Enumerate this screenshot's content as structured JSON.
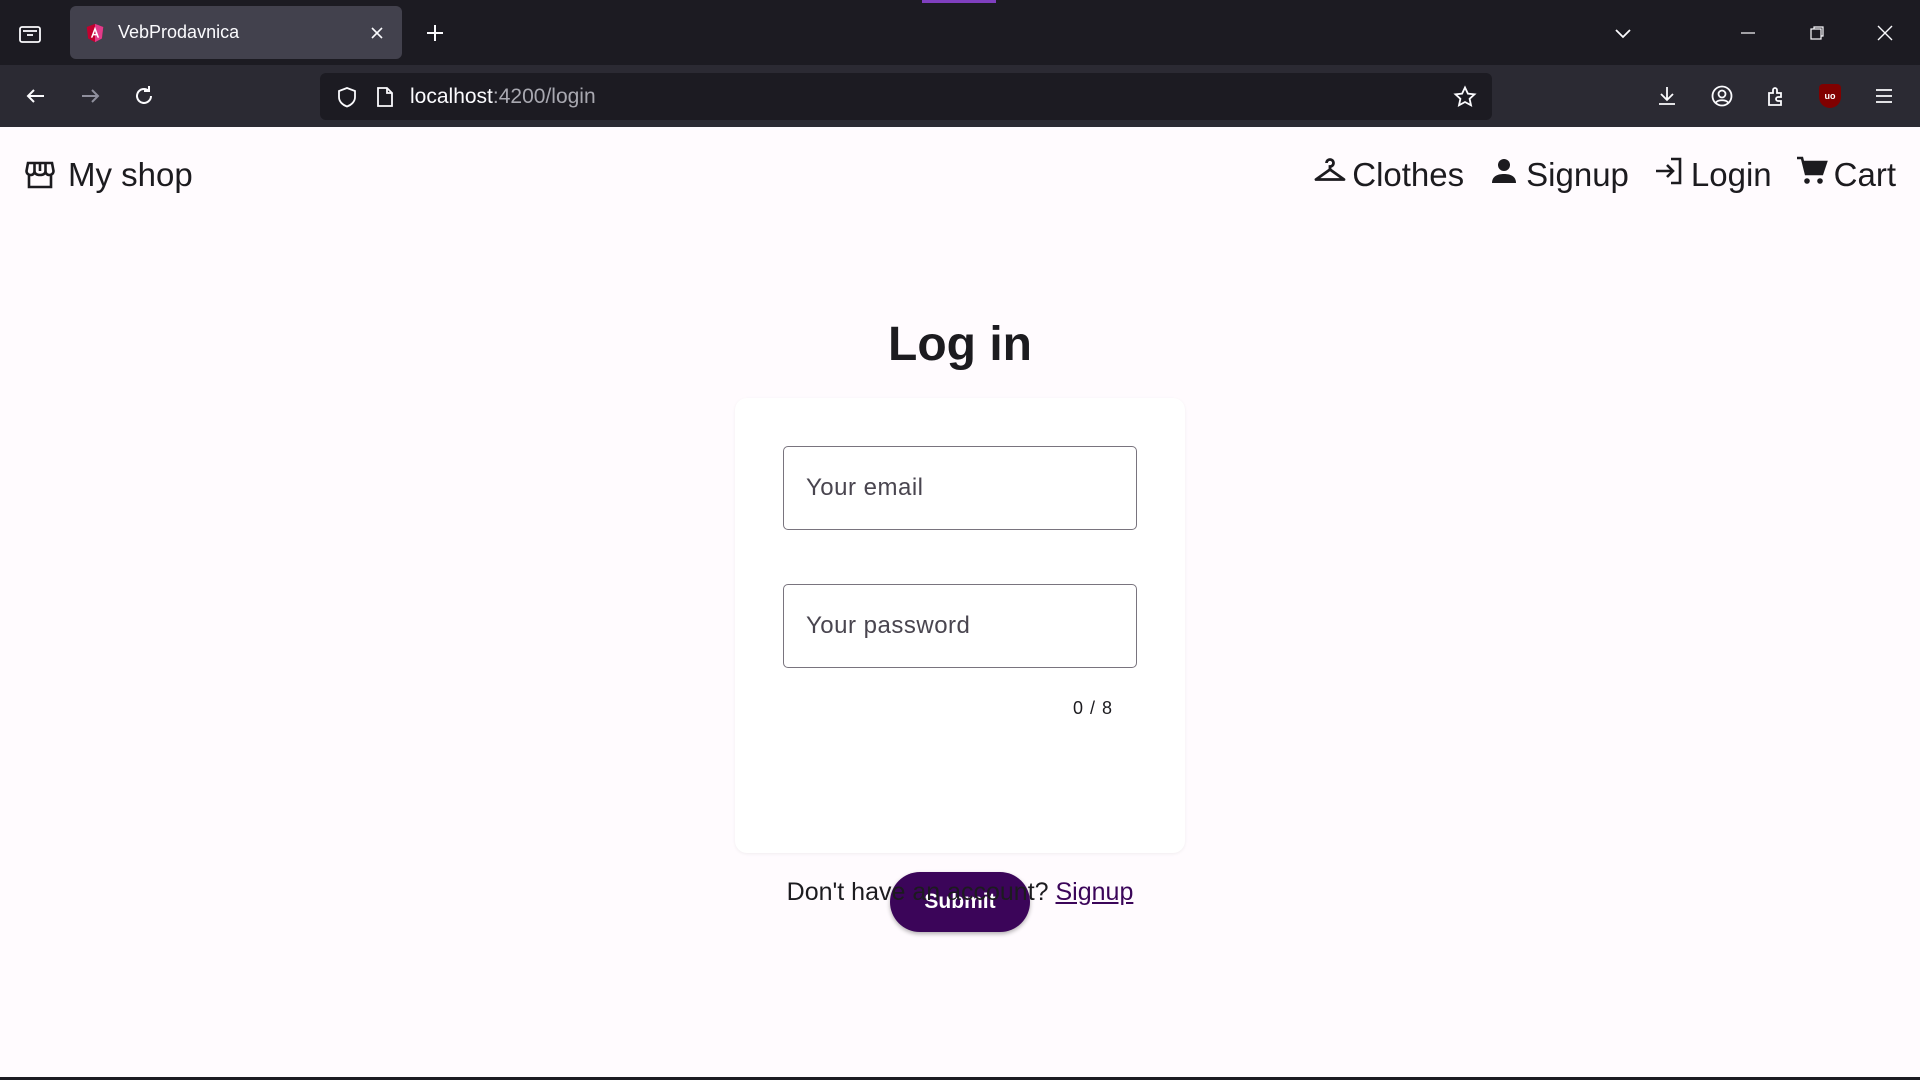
{
  "browser": {
    "tab_title": "VebProdavnica",
    "url_host": "localhost",
    "url_path": ":4200/login",
    "accent_color": "#7f3fbf"
  },
  "toolbar": {
    "brand": "My shop",
    "links": [
      {
        "label": "Clothes",
        "icon": "hanger-icon"
      },
      {
        "label": "Signup",
        "icon": "person-icon"
      },
      {
        "label": "Login",
        "icon": "login-icon"
      },
      {
        "label": "Cart",
        "icon": "cart-icon"
      }
    ]
  },
  "login": {
    "heading": "Log in",
    "email_placeholder": "Your email",
    "password_placeholder": "Your password",
    "password_hint": "0 / 8",
    "submit_label": "Submit",
    "footer_text": "Don't have an account?",
    "footer_link": "Signup",
    "primary_color": "#3b0559"
  }
}
